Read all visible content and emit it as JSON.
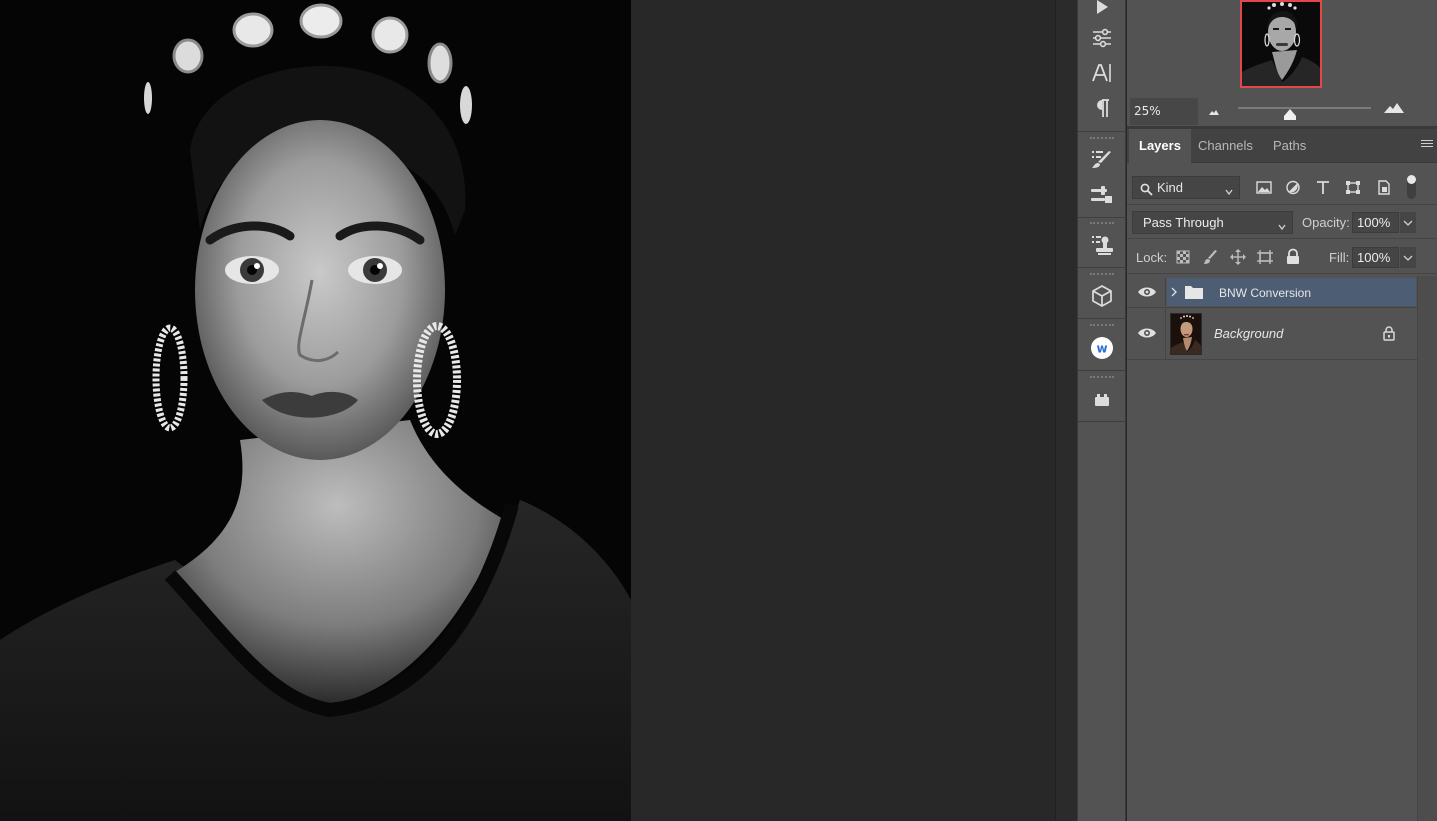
{
  "navigator": {
    "zoom_value": "25%"
  },
  "layers_panel": {
    "tabs": [
      {
        "label": "Layers",
        "active": true
      },
      {
        "label": "Channels",
        "active": false
      },
      {
        "label": "Paths",
        "active": false
      }
    ],
    "filter": {
      "kind_label": "Kind"
    },
    "blend_mode": "Pass Through",
    "opacity_label": "Opacity:",
    "opacity_value": "100%",
    "lock_label": "Lock:",
    "fill_label": "Fill:",
    "fill_value": "100%",
    "layers": [
      {
        "name": "BNW Conversion",
        "type": "group",
        "visible": true,
        "selected": true
      },
      {
        "name": "Background",
        "type": "pixel",
        "visible": true,
        "selected": false,
        "locked": true
      }
    ]
  },
  "colors": {
    "selected_row": "#4c5d74",
    "navigator_frame": "#e2474b",
    "panel_bg": "#535353",
    "canvas_bg": "#282828"
  },
  "toolbar_icons": [
    "play-icon",
    "adjustments-icon",
    "character-icon",
    "paragraph-icon",
    "brush-settings-icon",
    "tool-presets-icon",
    "clone-source-icon",
    "3d-icon",
    "w-plugin-icon",
    "plugin-icon"
  ]
}
